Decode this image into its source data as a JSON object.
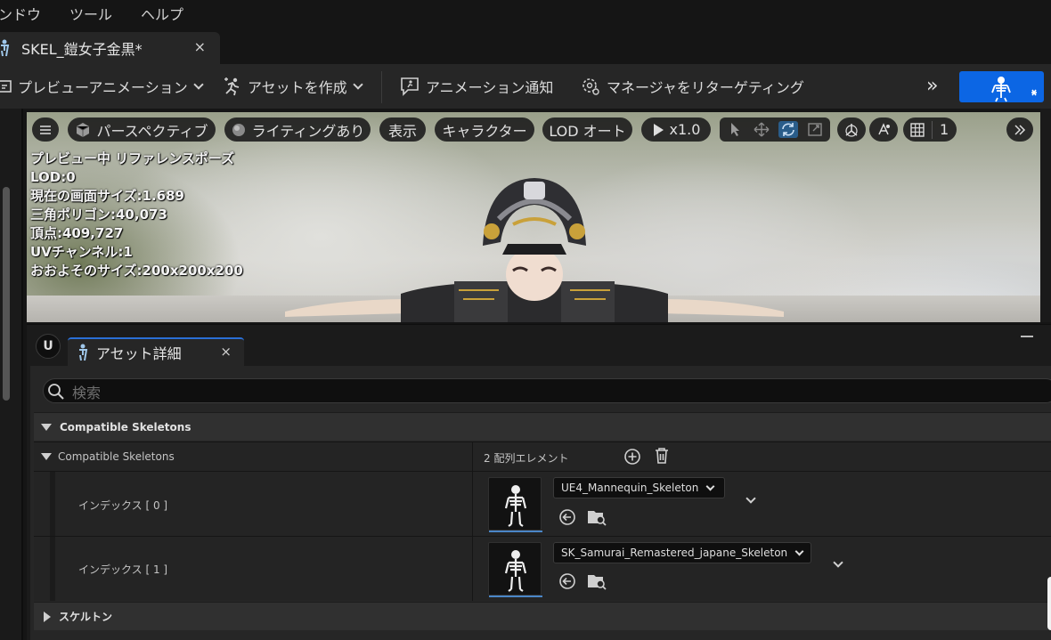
{
  "menubar": {
    "items": [
      "ンドウ",
      "ツール",
      "ヘルプ"
    ]
  },
  "document_tab": {
    "title": "SKEL_鎧女子金黒*",
    "close": "×"
  },
  "toolbar": {
    "preview_animation": "プレビューアニメーション",
    "create_asset": "アセットを作成",
    "anim_notify": "アニメーション通知",
    "retarget_manager": "マネージャをリターゲティング",
    "more": "»"
  },
  "viewport": {
    "perspective": "パースペクティブ",
    "lighting": "ライティングあり",
    "show": "表示",
    "character": "キャラクター",
    "lod": "LOD オート",
    "speed": "x1.0",
    "grid_value": "1",
    "stats": [
      "プレビュー中 リファレンスポーズ",
      "LOD:0",
      "現在の画面サイズ:1.689",
      "三角ポリゴン:40,073",
      "頂点:409,727",
      "UVチャンネル:1",
      "おおよそのサイズ:200x200x200"
    ]
  },
  "details_panel": {
    "tab_title": "アセット詳細",
    "close": "×",
    "search_placeholder": "検索",
    "category_compatible": "Compatible Skeletons",
    "property_compatible": "Compatible Skeletons",
    "array_count": "2 配列エレメント",
    "rows": [
      {
        "label": "インデックス [ 0 ]",
        "value": "UE4_Mannequin_Skeleton"
      },
      {
        "label": "インデックス [ 1 ]",
        "value": "SK_Samurai_Remastered_japane_Skeleton"
      }
    ],
    "category_skeleton": "スケルトン"
  },
  "colors": {
    "accent_blue": "#0c66e4",
    "panel_bg": "#262626",
    "selected_tab_line": "#2a6fd6"
  }
}
